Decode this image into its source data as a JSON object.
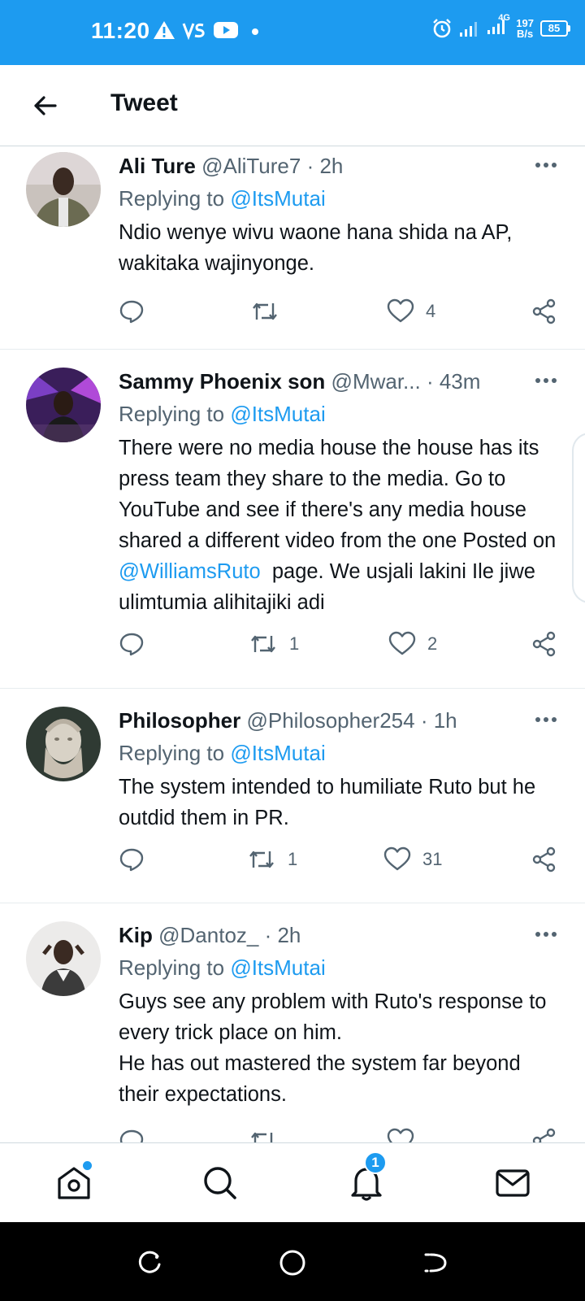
{
  "status_bar": {
    "time": "11:20",
    "network": "4G",
    "speed_value": "197",
    "speed_unit": "B/s",
    "battery": "85",
    "color": "#1d9bf0"
  },
  "header": {
    "title": "Tweet"
  },
  "tweets": [
    {
      "name": "Ali Ture",
      "handle": "@AliTure7",
      "time": "· 2h",
      "replying_label": "Replying to",
      "replying_handle": "@ItsMutai",
      "text": "Ndio wenye wivu waone hana shida na AP, wakitaka wajinyonge.",
      "retweets": "",
      "likes": "4"
    },
    {
      "name": "Sammy Phoenix son",
      "handle": "@Mwar...",
      "time": "· 43m",
      "replying_label": "Replying to",
      "replying_handle": "@ItsMutai",
      "text_before": "There were no media house the house has its press team they share to the media. Go to YouTube and see if there's any media house shared a different video from the one Posted on ",
      "mention": "@WilliamsRuto",
      "text_after": "  page. We usjali lakini Ile jiwe ulimtumia alihitajiki adi",
      "retweets": "1",
      "likes": "2"
    },
    {
      "name": "Philosopher",
      "handle": "@Philosopher254",
      "time": "· 1h",
      "replying_label": "Replying to",
      "replying_handle": "@ItsMutai",
      "text": "The system intended to humiliate Ruto but he outdid them in PR.",
      "retweets": "1",
      "likes": "31"
    },
    {
      "name": "Kip",
      "handle": "@Dantoz_",
      "time": "· 2h",
      "replying_label": "Replying to",
      "replying_handle": "@ItsMutai",
      "text_line1": "Guys see any problem with Ruto's response to every trick place on him.",
      "text_line2": "He has out mastered the system far beyond their expectations."
    }
  ],
  "bottom_nav": {
    "notifications_badge": "1",
    "items": [
      "home-icon",
      "search-icon",
      "notifications-icon",
      "messages-icon"
    ]
  },
  "colors": {
    "accent": "#1d9bf0",
    "text": "#0f1419",
    "secondary": "#536471"
  }
}
